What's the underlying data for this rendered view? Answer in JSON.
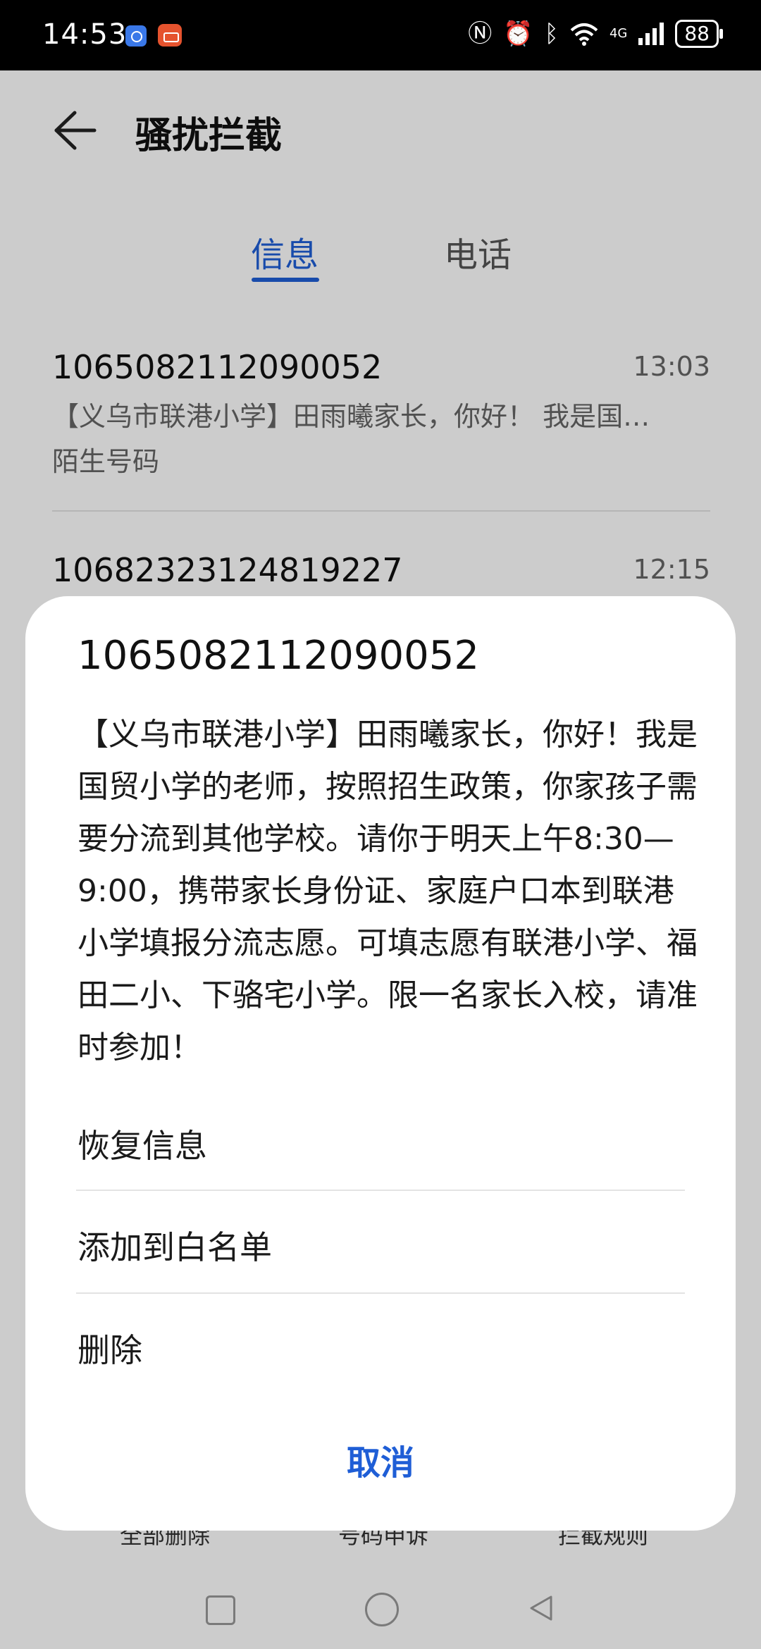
{
  "status_bar": {
    "time": "14:53",
    "battery": "88",
    "network": "4G",
    "icons": [
      "app-notification-icon",
      "app-notification-icon",
      "nfc-icon",
      "alarm-icon",
      "bluetooth-icon",
      "wifi-icon",
      "signal-icon",
      "battery-icon"
    ]
  },
  "header": {
    "title": "骚扰拦截",
    "back_icon": "back-arrow-icon"
  },
  "tabs": [
    {
      "label": "信息",
      "selected": true
    },
    {
      "label": "电话",
      "selected": false
    }
  ],
  "messages": [
    {
      "number": "1065082112090052",
      "time": "13:03",
      "preview": "【义乌市联港小学】田雨曦家长，你好！ 我是国…",
      "tag": "陌生号码"
    },
    {
      "number": "10682323124819227",
      "time": "12:15"
    }
  ],
  "bottom_bar": {
    "delete_all": "全部删除",
    "appeal": "号码申诉",
    "rules": "拦截规则"
  },
  "dialog": {
    "number": "1065082112090052",
    "body": "【义乌市联港小学】田雨曦家长，你好！我是国贸小学的老师，按照招生政策，你家孩子需要分流到其他学校。请你于明天上午8:30—9:00，携带家长身份证、家庭户口本到联港小学填报分流志愿。可填志愿有联港小学、福田二小、下骆宅小学。限一名家长入校，请准时参加！",
    "options": [
      "恢复信息",
      "添加到白名单",
      "删除"
    ],
    "cancel": "取消"
  },
  "colors": {
    "accent": "#1f5ed6",
    "scrim": "rgba(0,0,0,0.2)"
  }
}
